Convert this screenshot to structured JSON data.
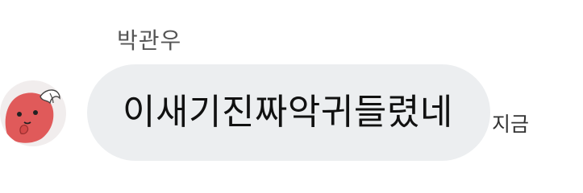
{
  "chat": {
    "sender_name": "박관우",
    "message": "이새기진짜악귀들렸네",
    "timestamp": "지금",
    "avatar_icon": "red-blob-character-icon",
    "colors": {
      "bubble": "#eceef0",
      "avatar_bg": "#f1eded",
      "avatar_character": "#e05a5a"
    }
  }
}
